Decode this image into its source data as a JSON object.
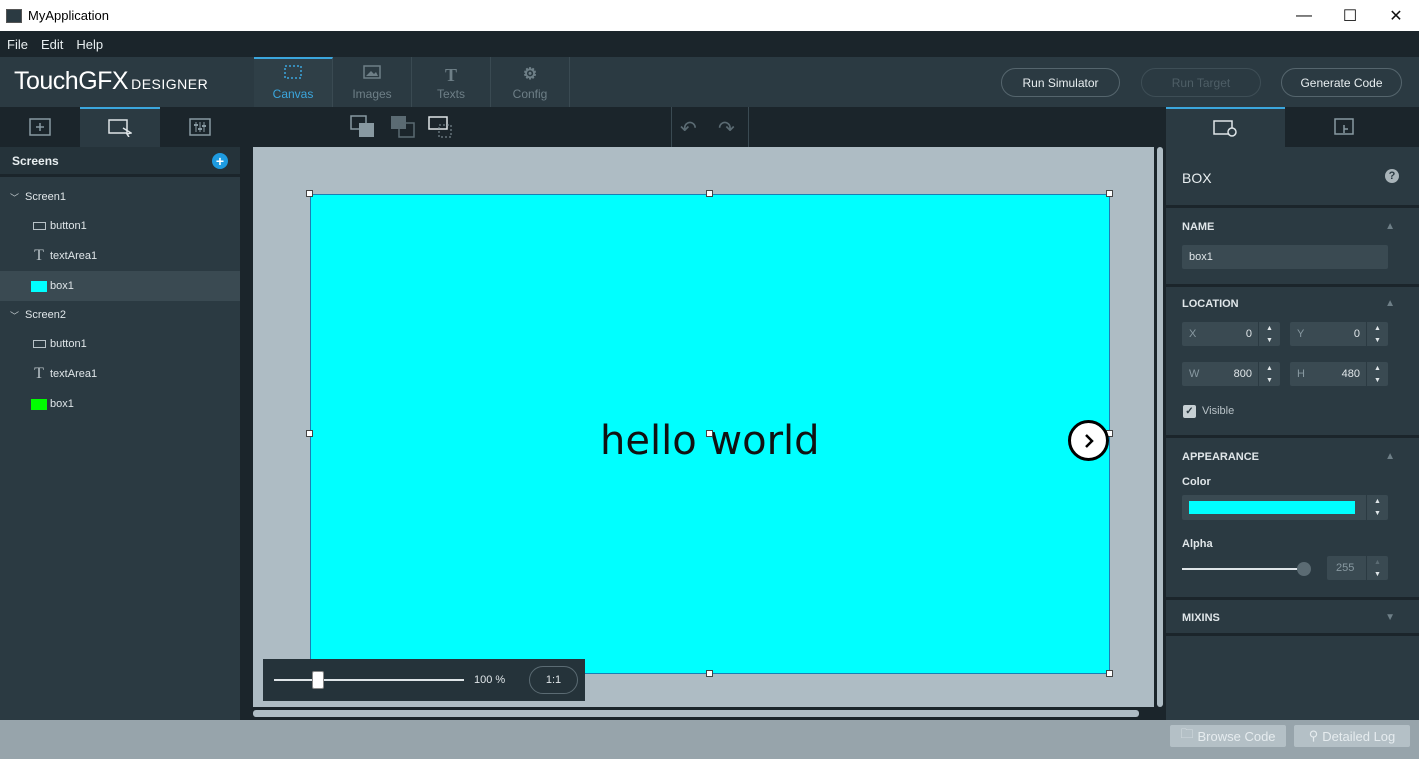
{
  "window": {
    "title": "MyApplication",
    "minimize": "—",
    "maximize": "☐",
    "close": "✕"
  },
  "menu": [
    "File",
    "Edit",
    "Help"
  ],
  "logo": {
    "main": "TouchGFX",
    "sub": "DESIGNER"
  },
  "modes": [
    {
      "label": "Canvas",
      "icon": "canvas-icon",
      "active": true
    },
    {
      "label": "Images",
      "icon": "image-icon",
      "active": false
    },
    {
      "label": "Texts",
      "icon": "text-icon",
      "active": false
    },
    {
      "label": "Config",
      "icon": "gear-icon",
      "active": false
    }
  ],
  "toolbar_buttons": {
    "run_simulator": "Run Simulator",
    "run_target": "Run Target",
    "generate_code": "Generate Code"
  },
  "screens_panel": {
    "title": "Screens",
    "screens": [
      {
        "name": "Screen1",
        "items": [
          {
            "label": "button1",
            "type": "button"
          },
          {
            "label": "textArea1",
            "type": "text"
          },
          {
            "label": "box1",
            "type": "box",
            "color": "#00ffff",
            "selected": true
          }
        ]
      },
      {
        "name": "Screen2",
        "items": [
          {
            "label": "button1",
            "type": "button"
          },
          {
            "label": "textArea1",
            "type": "text"
          },
          {
            "label": "box1",
            "type": "box",
            "color": "#00ff00",
            "selected": false
          }
        ]
      }
    ]
  },
  "canvas": {
    "text": "hello world",
    "box_color": "#00ffff",
    "zoom_percent": "100 %",
    "zoom_reset": "1:1",
    "zoom_slider_fraction": 0.2
  },
  "properties": {
    "widget_type": "BOX",
    "name_section": "NAME",
    "name_value": "box1",
    "location_section": "LOCATION",
    "x_label": "X",
    "x_value": "0",
    "y_label": "Y",
    "y_value": "0",
    "w_label": "W",
    "w_value": "800",
    "h_label": "H",
    "h_value": "480",
    "visible_label": "Visible",
    "visible_checked": true,
    "appearance_section": "APPEARANCE",
    "color_label": "Color",
    "color_value": "#00ffff",
    "alpha_label": "Alpha",
    "alpha_value": "255",
    "mixins_section": "MIXINS"
  },
  "status": {
    "browse_code": "Browse Code",
    "detailed_log": "Detailed Log"
  },
  "colors": {
    "accent": "#3ba6dd",
    "add_button": "#1e9be0"
  }
}
